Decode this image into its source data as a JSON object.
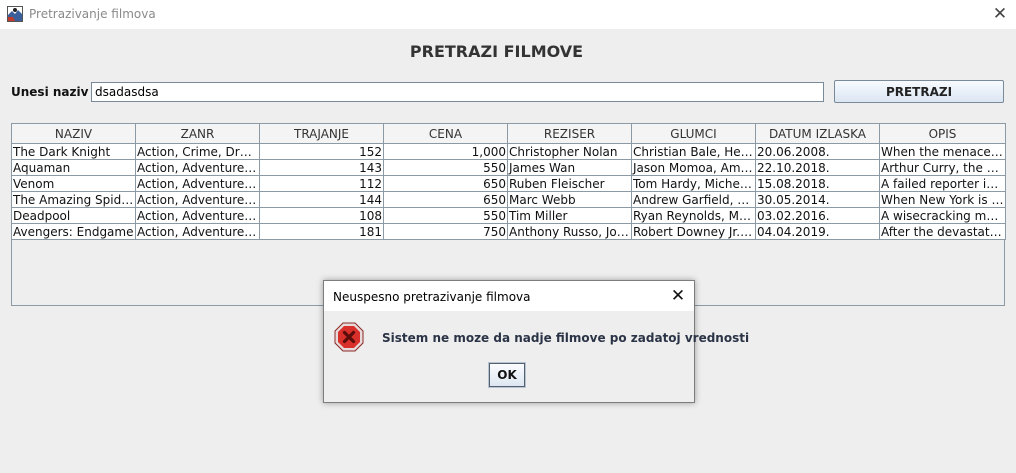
{
  "window": {
    "title": "Pretrazivanje filmova",
    "close_glyph": "✕",
    "icon": "app-icon"
  },
  "page": {
    "title": "PRETRAZI FILMOVE"
  },
  "search": {
    "label": "Unesi naziv",
    "value": "dsadasdsa",
    "button_label": "PRETRAZI"
  },
  "table": {
    "columns": [
      "NAZIV",
      "ZANR",
      "TRAJANJE",
      "CENA",
      "REZISER",
      "GLUMCI",
      "DATUM IZLASKA",
      "OPIS"
    ],
    "rows": [
      [
        "The Dark Knight",
        "Action, Crime, Drama",
        "152",
        "1,000",
        "Christopher Nolan",
        "Christian Bale, Heat...",
        "20.06.2008.",
        "When the menace k..."
      ],
      [
        "Aquaman",
        "Action, Adventure, F...",
        "143",
        "550",
        "James Wan",
        "Jason Momoa, Amb...",
        "22.10.2018.",
        "Arthur Curry, the hu..."
      ],
      [
        "Venom",
        "Action, Adventure, S...",
        "112",
        "650",
        "Ruben Fleischer",
        "Tom Hardy, Michelle...",
        "15.08.2018.",
        "A failed reporter is b..."
      ],
      [
        "The Amazing Spider...",
        "Action, Adventure, S...",
        "144",
        "650",
        "Marc Webb",
        "Andrew Garfield, Em...",
        "30.05.2014.",
        "When New York is p..."
      ],
      [
        "Deadpool",
        "Action, Adventure, C...",
        "108",
        "550",
        "Tim Miller",
        "Ryan Reynolds, Mor...",
        "03.02.2016.",
        "A wisecracking mer..."
      ],
      [
        "Avengers: Endgame",
        "Action, Adventure, Dr...",
        "181",
        "750",
        "Anthony Russo, Joe ...",
        "Robert Downey Jr., ...",
        "04.04.2019.",
        "After the devastating..."
      ]
    ]
  },
  "dialog": {
    "title": "Neuspesno pretrazivanje filmova",
    "message": "Sistem ne moze da nadje filmove po zadatoj vrednosti",
    "ok_label": "OK",
    "close_glyph": "✕",
    "icon": "error-icon"
  },
  "colors": {
    "background": "#eeeeee",
    "border": "#8c9aa6",
    "error_red": "#d9302b"
  }
}
